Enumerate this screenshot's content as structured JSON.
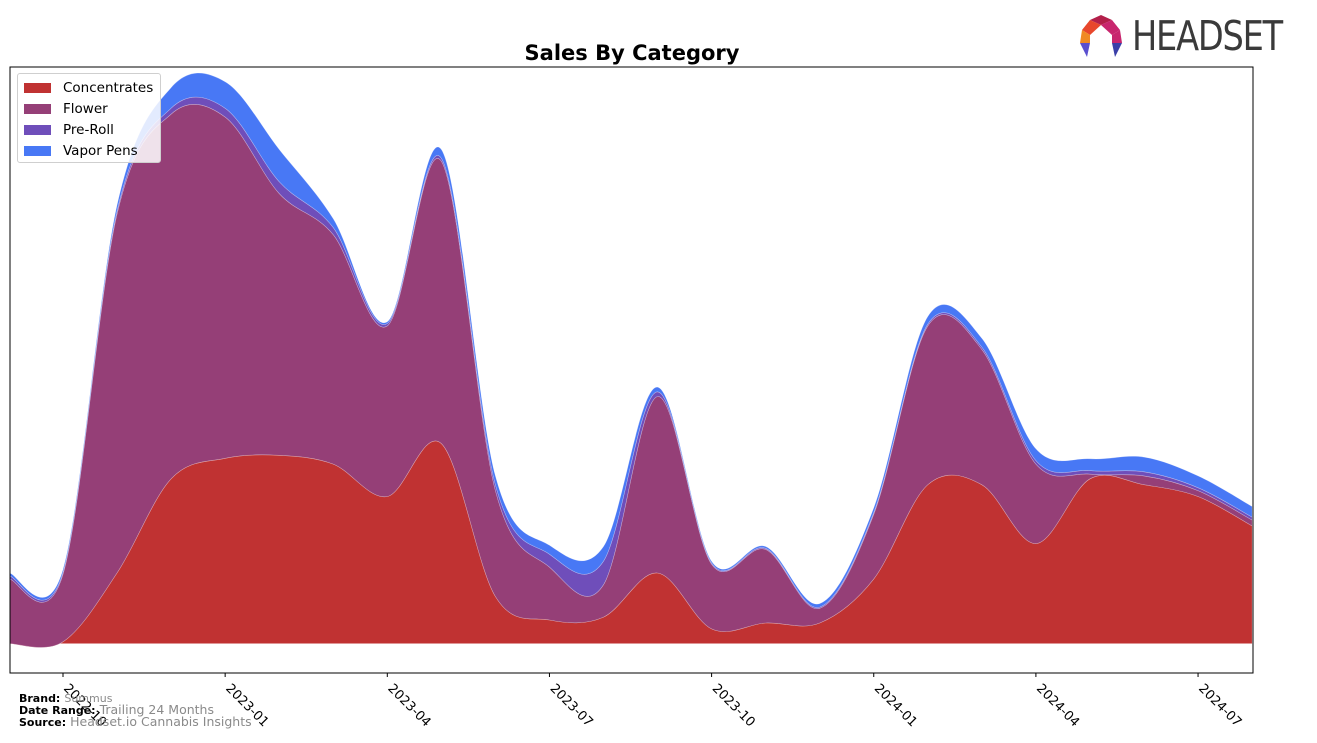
{
  "logo": {
    "text": "HEADSET",
    "colors": [
      "#e8472c",
      "#b31f4a",
      "#c8266e",
      "#f08a24",
      "#5a4fcf",
      "#3a3fa8"
    ]
  },
  "footer": {
    "brand_key": "Brand:",
    "brand_val": "Summus",
    "range_key": "Date Range:",
    "range_val": "Trailing 24 Months",
    "source_key": "Source:",
    "source_val": "Headset.io Cannabis Insights"
  },
  "chart_data": {
    "type": "area",
    "stacked": true,
    "smoothed": true,
    "title": "Sales By Category",
    "xlabel": "",
    "ylabel": "",
    "x": [
      "2022-09",
      "2022-10",
      "2022-11",
      "2022-12",
      "2023-01",
      "2023-02",
      "2023-03",
      "2023-04",
      "2023-05",
      "2023-06",
      "2023-07",
      "2023-08",
      "2023-09",
      "2023-10",
      "2023-11",
      "2023-12",
      "2024-01",
      "2024-02",
      "2024-03",
      "2024-04",
      "2024-05",
      "2024-06",
      "2024-07",
      "2024-08"
    ],
    "x_ticks": [
      "2022-10",
      "2023-01",
      "2023-04",
      "2023-07",
      "2023-10",
      "2024-01",
      "2024-04",
      "2024-07"
    ],
    "ylim": [
      -5,
      98
    ],
    "y_ticks_visible": false,
    "grid": false,
    "legend_position": "top-left",
    "series": [
      {
        "name": "Concentrates",
        "color": "#c03232",
        "values": [
          0,
          0.3,
          12,
          28,
          31.5,
          32,
          30.5,
          25,
          34,
          8,
          4,
          4.5,
          12,
          2.5,
          3.5,
          3.5,
          11,
          27,
          27,
          17,
          28,
          27,
          25,
          20
        ]
      },
      {
        "name": "Flower",
        "color": "#953f77",
        "values": [
          11,
          11.5,
          61,
          62,
          58,
          44.5,
          39,
          29,
          48,
          18,
          9,
          5.5,
          30,
          11,
          12.5,
          2.5,
          11,
          27,
          23,
          13.5,
          0.8,
          1.5,
          1.0,
          1.0
        ]
      },
      {
        "name": "Pre-Roll",
        "color": "#6f4eba",
        "values": [
          0.5,
          0.3,
          0.5,
          1.0,
          1.5,
          2.0,
          1.2,
          0.4,
          0.5,
          1.0,
          2.2,
          4.0,
          0.8,
          0.2,
          0.2,
          0.2,
          0.3,
          0.3,
          0.4,
          0.6,
          0.6,
          0.7,
          0.5,
          0.5
        ]
      },
      {
        "name": "Vapor Pens",
        "color": "#4878f5",
        "values": [
          0.5,
          0.5,
          1.0,
          3.5,
          4.5,
          5.5,
          1.5,
          0.3,
          1.5,
          1.5,
          1.5,
          2.5,
          0.8,
          0.3,
          0.3,
          0.6,
          0.8,
          1.3,
          1.5,
          2.0,
          2.0,
          2.5,
          2.0,
          1.8
        ]
      }
    ]
  }
}
